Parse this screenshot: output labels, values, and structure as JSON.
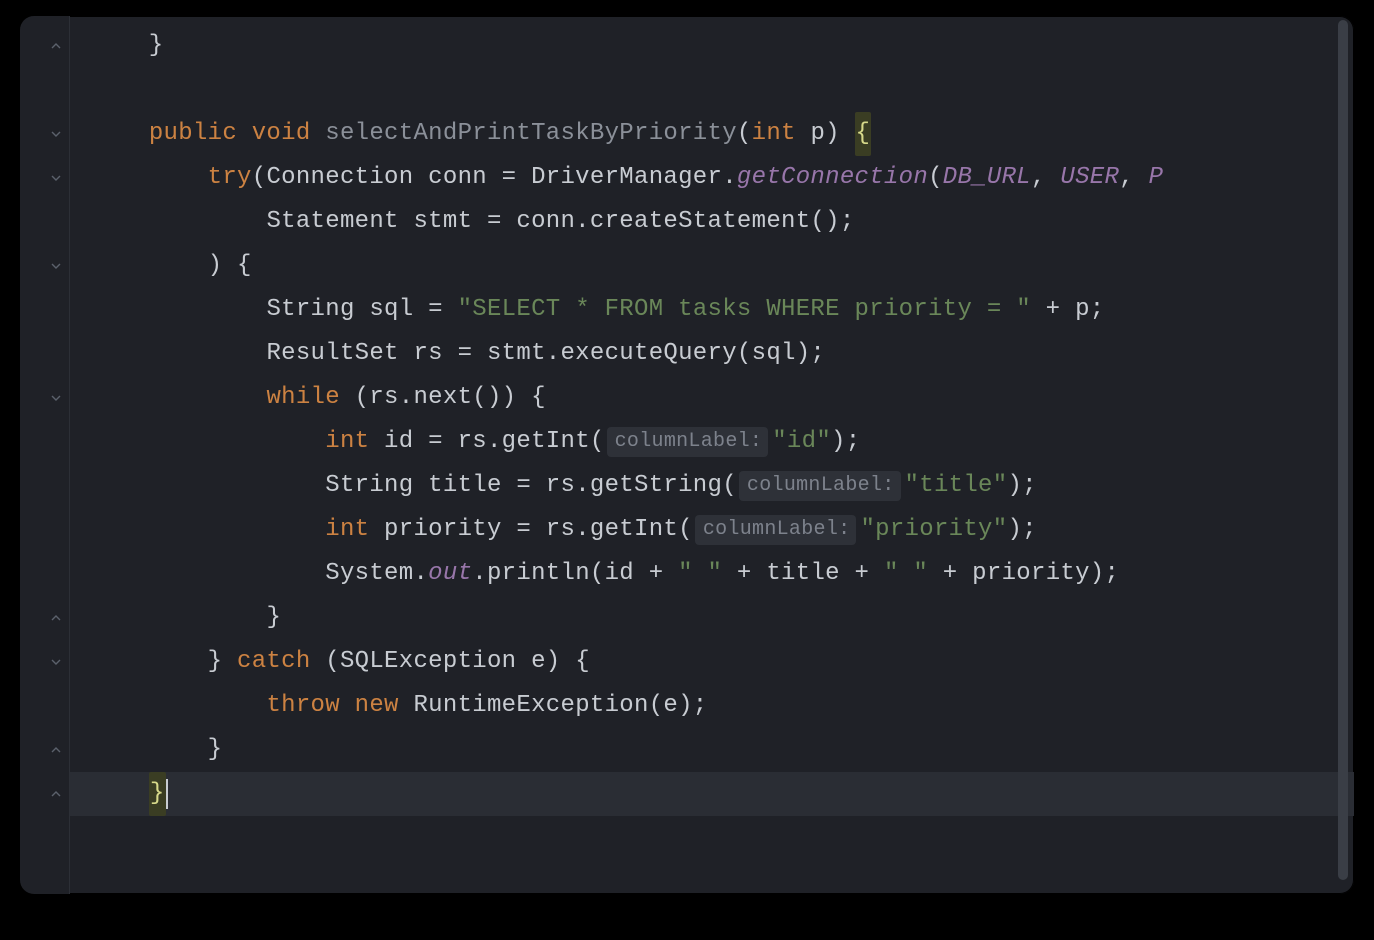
{
  "code": {
    "l1": "    }",
    "l2": "",
    "l3a": "    ",
    "l3_kw_public": "public",
    "l3_sp1": " ",
    "l3_kw_void": "void",
    "l3_sp2": " ",
    "l3_method": "selectAndPrintTaskByPriority",
    "l3_paren_o": "(",
    "l3_kw_int": "int",
    "l3_sp3": " ",
    "l3_param": "p",
    "l3_paren_c": ") ",
    "l3_brace": "{",
    "l4_ind": "        ",
    "l4_try": "try",
    "l4_po": "(",
    "l4_conn_t": "Connection conn = DriverManager.",
    "l4_getconn": "getConnection",
    "l4_po2": "(",
    "l4_dburl": "DB_URL",
    "l4_c1": ", ",
    "l4_user": "USER",
    "l4_c2": ", ",
    "l4_p": "P",
    "l5_ind": "            ",
    "l5_t": "Statement stmt = conn.createStatement();",
    "l6_ind": "        ",
    "l6_t": ") {",
    "l7_ind": "            ",
    "l7_a": "String sql = ",
    "l7_s": "\"SELECT * FROM tasks WHERE priority = \"",
    "l7_b": " + p;",
    "l8_ind": "            ",
    "l8_t": "ResultSet rs = stmt.executeQuery(sql);",
    "l9_ind": "            ",
    "l9_while": "while",
    "l9_rest": " (rs.next()) {",
    "l10_ind": "                ",
    "l10_int": "int",
    "l10_a": " id = rs.getInt(",
    "l10_hint": "columnLabel:",
    "l10_s": "\"id\"",
    "l10_b": ");",
    "l11_ind": "                ",
    "l11_a": "String title = rs.getString(",
    "l11_hint": "columnLabel:",
    "l11_s": "\"title\"",
    "l11_b": ");",
    "l12_ind": "                ",
    "l12_int": "int",
    "l12_a": " priority = rs.getInt(",
    "l12_hint": "columnLabel:",
    "l12_s": "\"priority\"",
    "l12_b": ");",
    "l13_ind": "                ",
    "l13_a": "System.",
    "l13_out": "out",
    "l13_b": ".println(id + ",
    "l13_s1": "\" \"",
    "l13_c": " + title + ",
    "l13_s2": "\" \"",
    "l13_d": " + priority);",
    "l14_ind": "            ",
    "l14_t": "}",
    "l15_ind": "        ",
    "l15_a": "} ",
    "l15_catch": "catch",
    "l15_b": " (SQLException e) {",
    "l16_ind": "            ",
    "l16_throw": "throw",
    "l16_sp": " ",
    "l16_new": "new",
    "l16_b": " RuntimeException(e);",
    "l17_ind": "        ",
    "l17_t": "}",
    "l18_ind": "    ",
    "l18_t": "}"
  },
  "gutter": {
    "fold_rows": [
      1,
      3,
      4,
      6,
      9,
      14,
      15,
      17,
      18
    ]
  }
}
